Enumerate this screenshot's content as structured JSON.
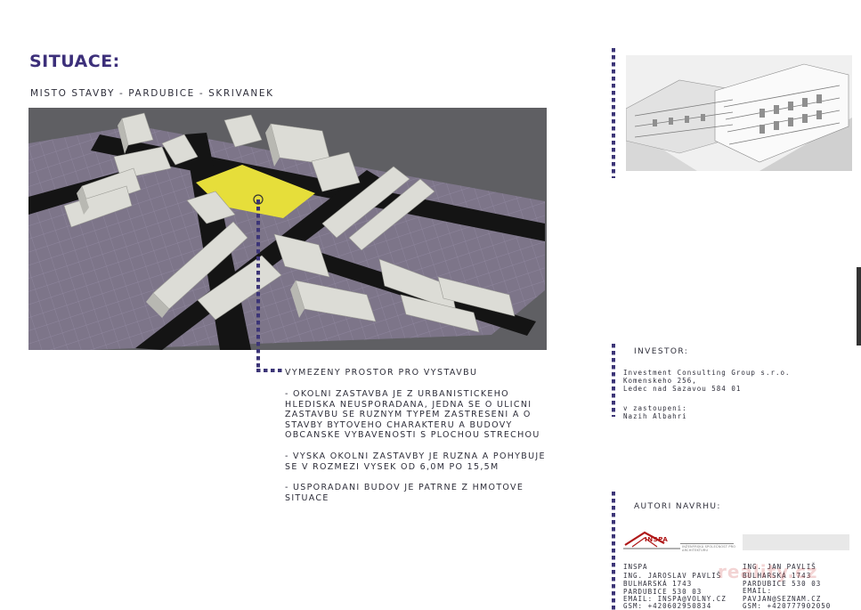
{
  "header": {
    "title": "SITUACE:",
    "subtitle": "MISTO STAVBY - PARDUBICE - SKRIVANEK"
  },
  "site_note": {
    "heading": "VYMEZENY PROSTOR PRO VYSTAVBU",
    "paragraphs": [
      "- OKOLNI ZASTAVBA JE Z URBANISTICKEHO HLEDISKA NEUSPORADANA, JEDNA SE O ULICNI ZASTAVBU SE RUZNYM TYPEM ZASTRESENI A O STAVBY BYTOVEHO CHARAKTERU A BUDOVY OBCANSKE VYBAVENOSTI S PLOCHOU STRECHOU",
      "- VYSKA OKOLNI ZASTAVBY JE RUZNA A POHYBUJE SE V ROZMEZI VYSEK OD 6,0M PO 15,5M",
      "- USPORADANI BUDOV JE PATRNE Z HMOTOVE SITUACE"
    ]
  },
  "investor": {
    "label": "INVESTOR:",
    "company": "Investment Consulting Group s.r.o.",
    "street": "Komenskeho 256,",
    "city": "Ledec nad Sazavou 584 01",
    "represented_label": "v zastoupeni:",
    "represented_name": "Nazih Albahri"
  },
  "authors": {
    "label": "AUTORI NAVRHU:",
    "logo_text": "INSPA",
    "logo_caption": "INŽENÝRSKÁ SPOLEČNOST PRO ARCHITEKTURU",
    "left": {
      "firm": "INSPA",
      "name": "ING. JAROSLAV PAVLIŠ",
      "street": "BULHARSKÁ 1743",
      "city": "PARDUBICE 530 03",
      "email": "EMAIL: INSPA@VOLNY.CZ",
      "gsm": "GSM: +420602950834"
    },
    "right": {
      "name": "ING. JAN PAVLIŠ",
      "street": "BULHARSKÁ 1743",
      "city": "PARDUBICE 530 03",
      "email_label": "EMAIL:",
      "email": "PAVJAN@SEZNAM.CZ",
      "gsm": "GSM: +420777902050"
    }
  },
  "watermark": "reality.cz",
  "colors": {
    "title": "#3c2f7a",
    "dots": "#3c3577",
    "plot_highlight": "#e6de3a",
    "ground": "#7d7589",
    "roads": "#141414",
    "buildings": "#d6d6d0"
  }
}
